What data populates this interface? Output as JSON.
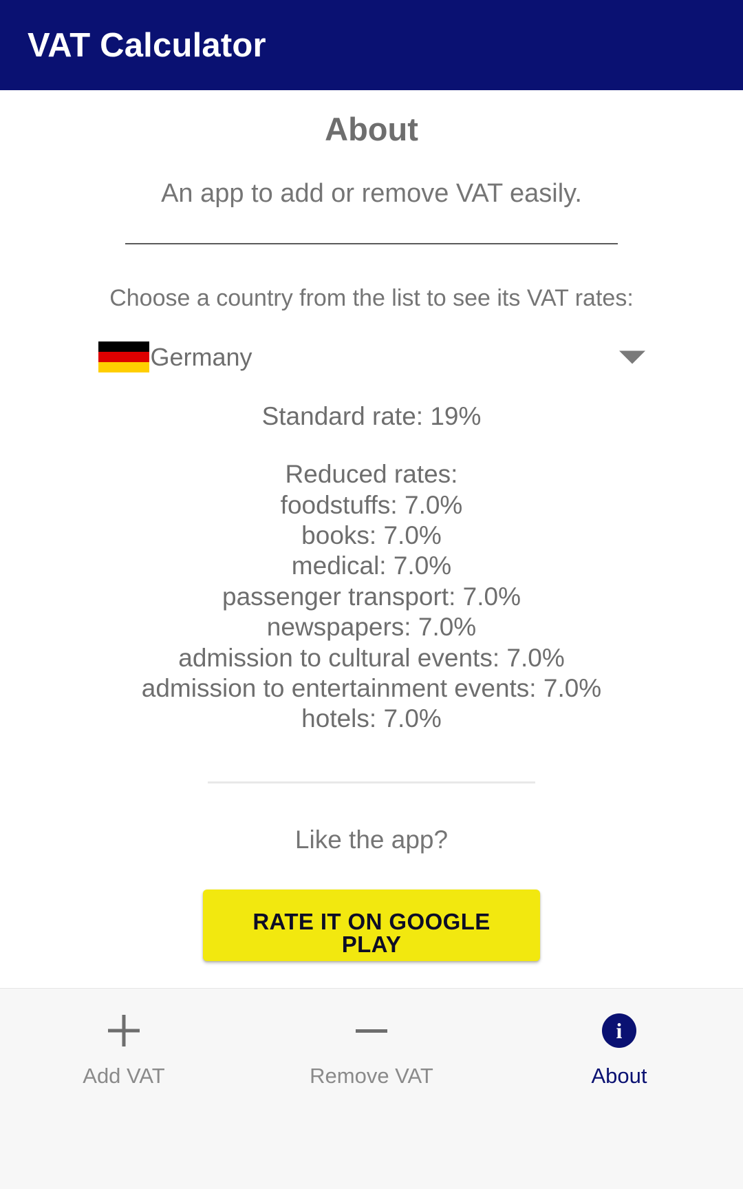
{
  "appbar": {
    "title": "VAT Calculator"
  },
  "about": {
    "heading": "About",
    "subtitle": "An app to add or remove VAT easily.",
    "choose_label": "Choose a country from the list to see its VAT rates:"
  },
  "country_selector": {
    "selected_country": "Germany",
    "flag": "germany-flag",
    "caret": "chevron-down-icon"
  },
  "rates": {
    "standard_line": "Standard rate: 19%",
    "reduced_heading": "Reduced rates:",
    "reduced_lines": [
      "foodstuffs: 7.0%",
      "books: 7.0%",
      "medical: 7.0%",
      "passenger transport: 7.0%",
      "newspapers: 7.0%",
      "admission to cultural events: 7.0%",
      "admission to entertainment events: 7.0%",
      "hotels: 7.0%"
    ]
  },
  "promo": {
    "like_text": "Like the app?",
    "rate_button_label": "RATE IT ON GOOGLE PLAY"
  },
  "bottom_nav": {
    "items": [
      {
        "label": "Add VAT",
        "icon": "plus-icon",
        "active": false
      },
      {
        "label": "Remove VAT",
        "icon": "minus-icon",
        "active": false
      },
      {
        "label": "About",
        "icon": "info-circle-icon",
        "active": true
      }
    ]
  },
  "colors": {
    "primary": "#0a1172",
    "accent_button": "#f2e80f",
    "text_muted": "#6e6e6e",
    "nav_background": "#f7f7f7"
  }
}
